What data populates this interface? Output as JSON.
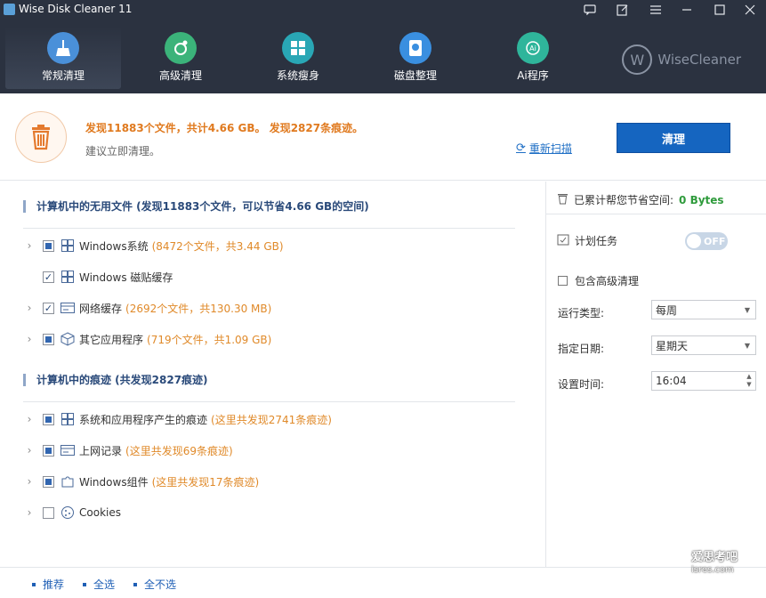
{
  "window": {
    "title": "Wise Disk Cleaner 11"
  },
  "nav": {
    "items": [
      {
        "label": "常规清理",
        "icon": "broom-icon"
      },
      {
        "label": "高级清理",
        "icon": "deep-clean-icon"
      },
      {
        "label": "系统瘦身",
        "icon": "windows-icon"
      },
      {
        "label": "磁盘整理",
        "icon": "defrag-icon"
      },
      {
        "label": "Ai程序",
        "icon": "ai-icon"
      }
    ],
    "brand": "WiseCleaner",
    "brand_letter": "W"
  },
  "summary": {
    "found": "发现11883个文件，共计4.66 GB。 发现2827条痕迹。",
    "advice": "建议立即清理。",
    "rescan": "重新扫描",
    "clean_button": "清理"
  },
  "junk": {
    "title": "计算机中的无用文件 (发现11883个文件，可以节省4.66 GB的空间)",
    "rows": [
      {
        "label": "Windows系统",
        "detail": "(8472个文件，共3.44 GB)"
      },
      {
        "label": "Windows 磁贴缓存",
        "detail": ""
      },
      {
        "label": "网络缓存",
        "detail": "(2692个文件，共130.30 MB)"
      },
      {
        "label": "其它应用程序",
        "detail": "(719个文件，共1.09 GB)"
      }
    ]
  },
  "traces": {
    "title": "计算机中的痕迹 (共发现2827痕迹)",
    "rows": [
      {
        "label": "系统和应用程序产生的痕迹",
        "detail": "(这里共发现2741条痕迹)"
      },
      {
        "label": "上网记录",
        "detail": "(这里共发现69条痕迹)"
      },
      {
        "label": "Windows组件",
        "detail": "(这里共发现17条痕迹)"
      },
      {
        "label": "Cookies",
        "detail": ""
      }
    ]
  },
  "right": {
    "saved_label": "已累计帮您节省空间:",
    "saved_value": "0 Bytes",
    "schedule_label": "计划任务",
    "toggle": "OFF",
    "advanced_label": "包含高级清理",
    "run_type_label": "运行类型:",
    "run_type_value": "每周",
    "day_label": "指定日期:",
    "day_value": "星期天",
    "time_label": "设置时间:",
    "time_value": "16:04"
  },
  "footer": {
    "recommend": "推荐",
    "select_all": "全选",
    "select_none": "全不选"
  },
  "watermark": {
    "line1": "爱思考吧",
    "line2": "isres.com"
  },
  "colors": {
    "titlebar": "#2b3240",
    "accent": "#1565c0",
    "orange": "#e07a1f",
    "green": "#2f9b3c"
  }
}
